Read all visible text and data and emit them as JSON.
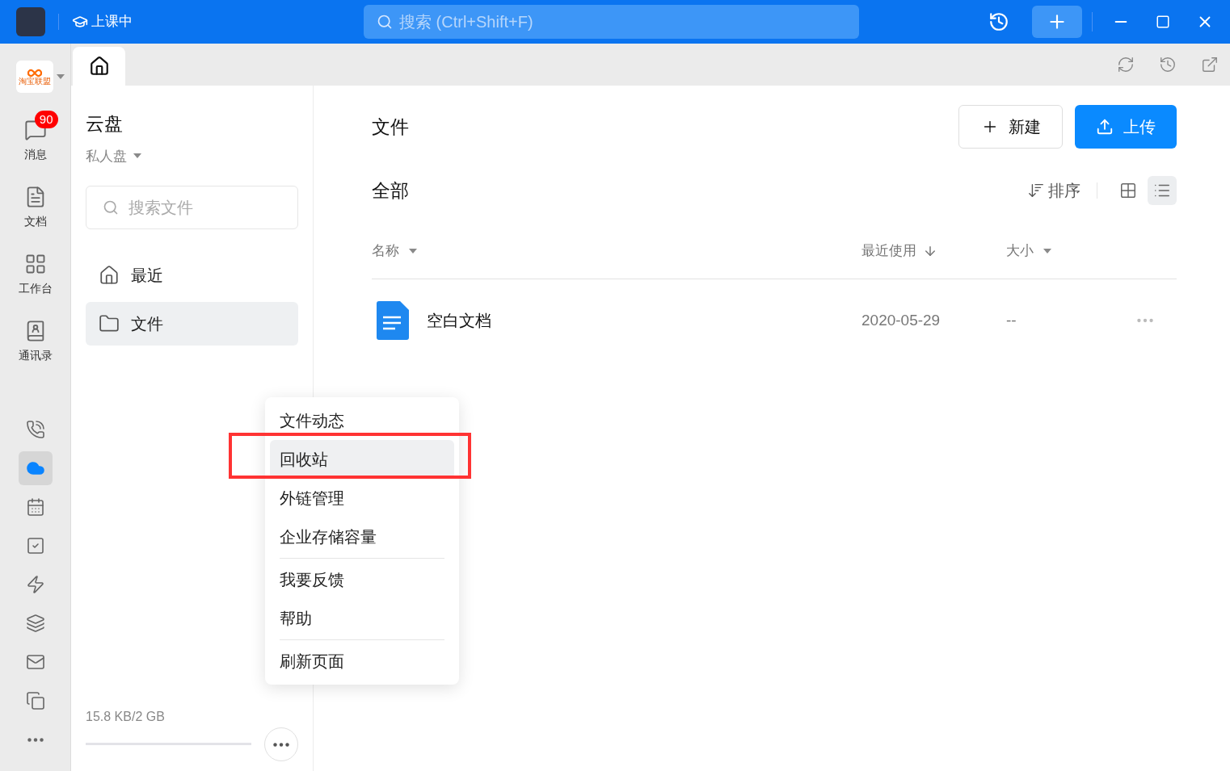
{
  "titlebar": {
    "status": "上课中",
    "search_placeholder": "搜索 (Ctrl+Shift+F)"
  },
  "rail": {
    "logo_text": "淘宝联盟",
    "items": [
      {
        "kind": "message",
        "label": "消息",
        "badge": "90"
      },
      {
        "kind": "docs",
        "label": "文档"
      },
      {
        "kind": "workbench",
        "label": "工作台"
      },
      {
        "kind": "contacts",
        "label": "通讯录"
      }
    ],
    "tools": [
      {
        "kind": "call",
        "selected": false
      },
      {
        "kind": "cloud",
        "selected": true
      },
      {
        "kind": "calendar",
        "selected": false
      },
      {
        "kind": "todo",
        "selected": false
      },
      {
        "kind": "flash",
        "selected": false
      },
      {
        "kind": "layers",
        "selected": false
      },
      {
        "kind": "mail",
        "selected": false
      },
      {
        "kind": "copy",
        "selected": false
      },
      {
        "kind": "more",
        "selected": false
      }
    ]
  },
  "tabs": [
    {
      "kind": "home",
      "selected": true
    }
  ],
  "sidebar": {
    "title": "云盘",
    "drive": "私人盘",
    "search_placeholder": "搜索文件",
    "nav": [
      {
        "kind": "recent",
        "label": "最近",
        "selected": false
      },
      {
        "kind": "folder",
        "label": "文件",
        "selected": true
      }
    ],
    "storage": "15.8 KB/2 GB"
  },
  "main": {
    "title": "文件",
    "new_button": "新建",
    "upload_button": "上传",
    "section": "全部",
    "sort": "排序",
    "views": [
      {
        "kind": "grid",
        "selected": false
      },
      {
        "kind": "list",
        "selected": true
      }
    ],
    "columns": [
      "名称",
      "最近使用",
      "大小"
    ],
    "rows": [
      {
        "name": "空白文档",
        "date": "2020-05-29",
        "size": "--"
      }
    ]
  },
  "menu": {
    "groups": [
      [
        {
          "label": "文件动态",
          "selected": false
        },
        {
          "label": "回收站",
          "selected": true
        },
        {
          "label": "外链管理",
          "selected": false
        },
        {
          "label": "企业存储容量",
          "selected": false
        }
      ],
      [
        {
          "label": "我要反馈",
          "selected": false
        },
        {
          "label": "帮助",
          "selected": false
        }
      ],
      [
        {
          "label": "刷新页面",
          "selected": false
        }
      ]
    ]
  }
}
